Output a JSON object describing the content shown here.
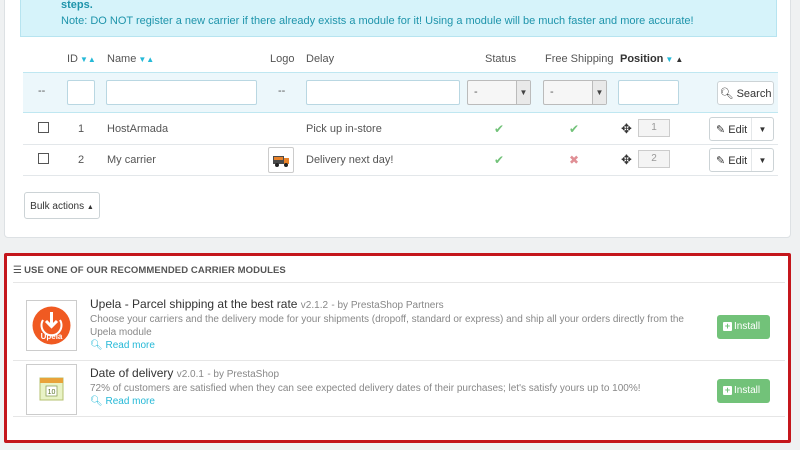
{
  "alert": {
    "line1": "steps.",
    "line2": "Note: DO NOT register a new carrier if there already exists a module for it! Using a module will be much faster and more accurate!"
  },
  "table": {
    "headers": {
      "id": "ID",
      "name": "Name",
      "logo": "Logo",
      "delay": "Delay",
      "status": "Status",
      "free_shipping": "Free Shipping",
      "position": "Position"
    },
    "filters": {
      "dash": "--",
      "status_select": "-",
      "free_select": "-",
      "search_label": "Search"
    },
    "rows": [
      {
        "id": "1",
        "name": "HostArmada",
        "delay": "Pick up in-store",
        "position": "1",
        "free_shipping": "yes"
      },
      {
        "id": "2",
        "name": "My carrier",
        "delay": "Delivery next day!",
        "position": "2",
        "free_shipping": "no"
      }
    ],
    "edit_label": "Edit",
    "bulk_label": "Bulk actions"
  },
  "modules": {
    "title": "Use one of our recommended carrier modules",
    "items": [
      {
        "name": "Upela - Parcel shipping at the best rate",
        "version": "v2.1.2",
        "by": "- by PrestaShop Partners",
        "description": "Choose your carriers and the delivery mode for your shipments (dropoff, standard or express) and ship all your orders directly from the Upela module",
        "read_more": "Read more",
        "install": "Install",
        "logo_text": "Upela"
      },
      {
        "name": "Date of delivery",
        "version": "v2.0.1",
        "by": "- by PrestaShop",
        "description": "72% of customers are satisfied when they can see expected delivery dates of their purchases; let's satisfy yours up to 100%!",
        "read_more": "Read more",
        "install": "Install",
        "logo_text": "10"
      }
    ]
  },
  "colors": {
    "accent": "#25b9d7",
    "success": "#72c279",
    "danger": "#e08f95",
    "highlight_border": "#c4161c"
  }
}
